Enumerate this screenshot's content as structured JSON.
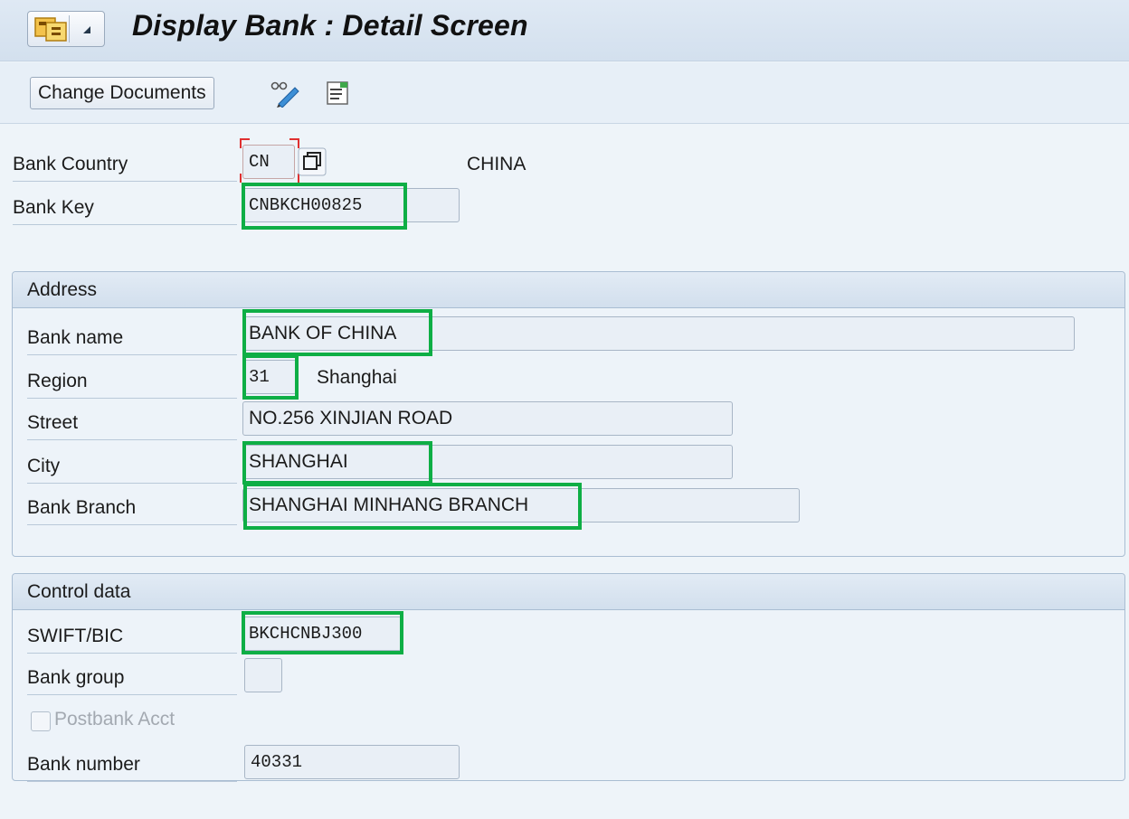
{
  "window": {
    "title": "Display Bank : Detail Screen"
  },
  "toolbar": {
    "change_documents_label": "Change Documents",
    "icons": [
      "glasses-pencil-icon",
      "details-list-icon"
    ]
  },
  "header_fields": {
    "bank_country": {
      "label": "Bank Country",
      "value": "CN",
      "description": "CHINA"
    },
    "bank_key": {
      "label": "Bank Key",
      "value": "CNBKCH00825"
    }
  },
  "address": {
    "title": "Address",
    "bank_name": {
      "label": "Bank name",
      "value": "BANK OF CHINA"
    },
    "region": {
      "label": "Region",
      "value": "31",
      "description": "Shanghai"
    },
    "street": {
      "label": "Street",
      "value": "NO.256 XINJIAN ROAD"
    },
    "city": {
      "label": "City",
      "value": "SHANGHAI"
    },
    "bank_branch": {
      "label": "Bank Branch",
      "value": "SHANGHAI MINHANG BRANCH"
    }
  },
  "control_data": {
    "title": "Control data",
    "swift_bic": {
      "label": "SWIFT/BIC",
      "value": "BKCHCNBJ300"
    },
    "bank_group": {
      "label": "Bank group",
      "value": ""
    },
    "postbank_acct": {
      "label": "Postbank Acct",
      "checked": false,
      "disabled": true
    },
    "bank_number": {
      "label": "Bank number",
      "value": "40331"
    }
  },
  "colors": {
    "highlight": "#0eae45",
    "required_marker": "#e03030",
    "background": "#eef4f9"
  }
}
